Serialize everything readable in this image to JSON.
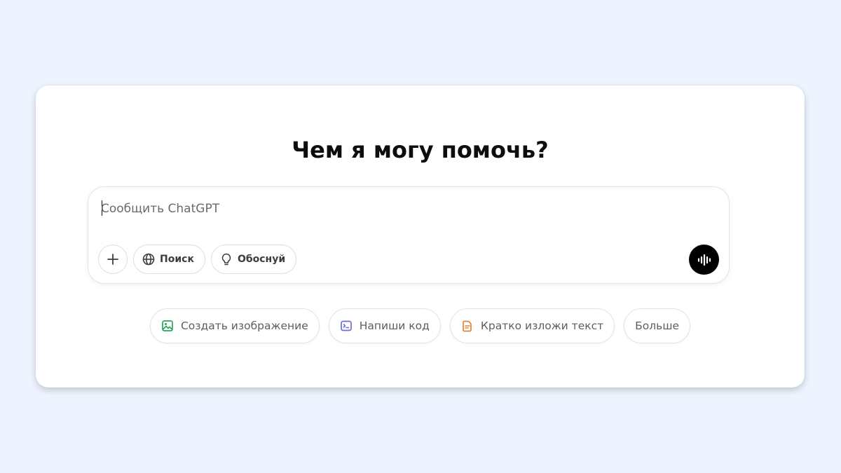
{
  "main": {
    "heading": "Чем я могу помочь?"
  },
  "composer": {
    "placeholder": "Сообщить ChatGPT",
    "value": "",
    "tools": {
      "attach_icon": "plus-icon",
      "search_label": "Поиск",
      "search_icon": "globe-icon",
      "reason_label": "Обоснуй",
      "reason_icon": "lightbulb-icon"
    },
    "voice_icon": "voice-waveform-icon"
  },
  "suggestions": [
    {
      "label": "Создать изображение",
      "icon": "image-icon",
      "color": "#2aa45a"
    },
    {
      "label": "Напиши код",
      "icon": "terminal-icon",
      "color": "#6b6fd6"
    },
    {
      "label": "Кратко изложи текст",
      "icon": "document-icon",
      "color": "#e0863a"
    },
    {
      "label": "Больше"
    }
  ],
  "colors": {
    "background": "#eef4ff",
    "card": "#ffffff",
    "voice_button": "#000000"
  }
}
